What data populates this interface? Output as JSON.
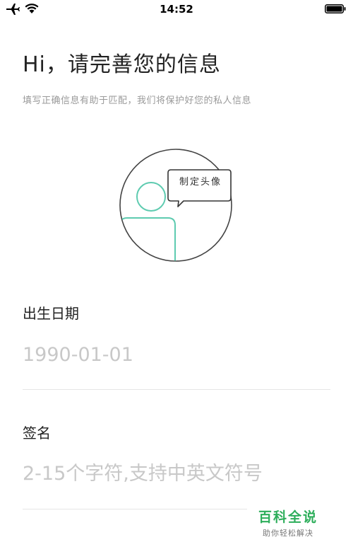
{
  "status_bar": {
    "time": "14:52",
    "icons": [
      "airplane-icon",
      "wifi-icon",
      "battery-icon"
    ]
  },
  "header": {
    "title": "Hi，请完善您的信息",
    "subtitle": "填写正确信息有助于匹配，我们将保护好您的私人信息"
  },
  "avatar": {
    "bubble_text": "制定头像",
    "accent_color": "#5ecbb0",
    "outline_color": "#444444"
  },
  "form": {
    "birthdate": {
      "label": "出生日期",
      "placeholder": "1990-01-01"
    },
    "signature": {
      "label": "签名",
      "placeholder": "2-15个字符,支持中英文符号"
    }
  },
  "watermark": {
    "title": "百科全说",
    "subtitle": "助你轻松解决",
    "color": "#2eae5b"
  }
}
